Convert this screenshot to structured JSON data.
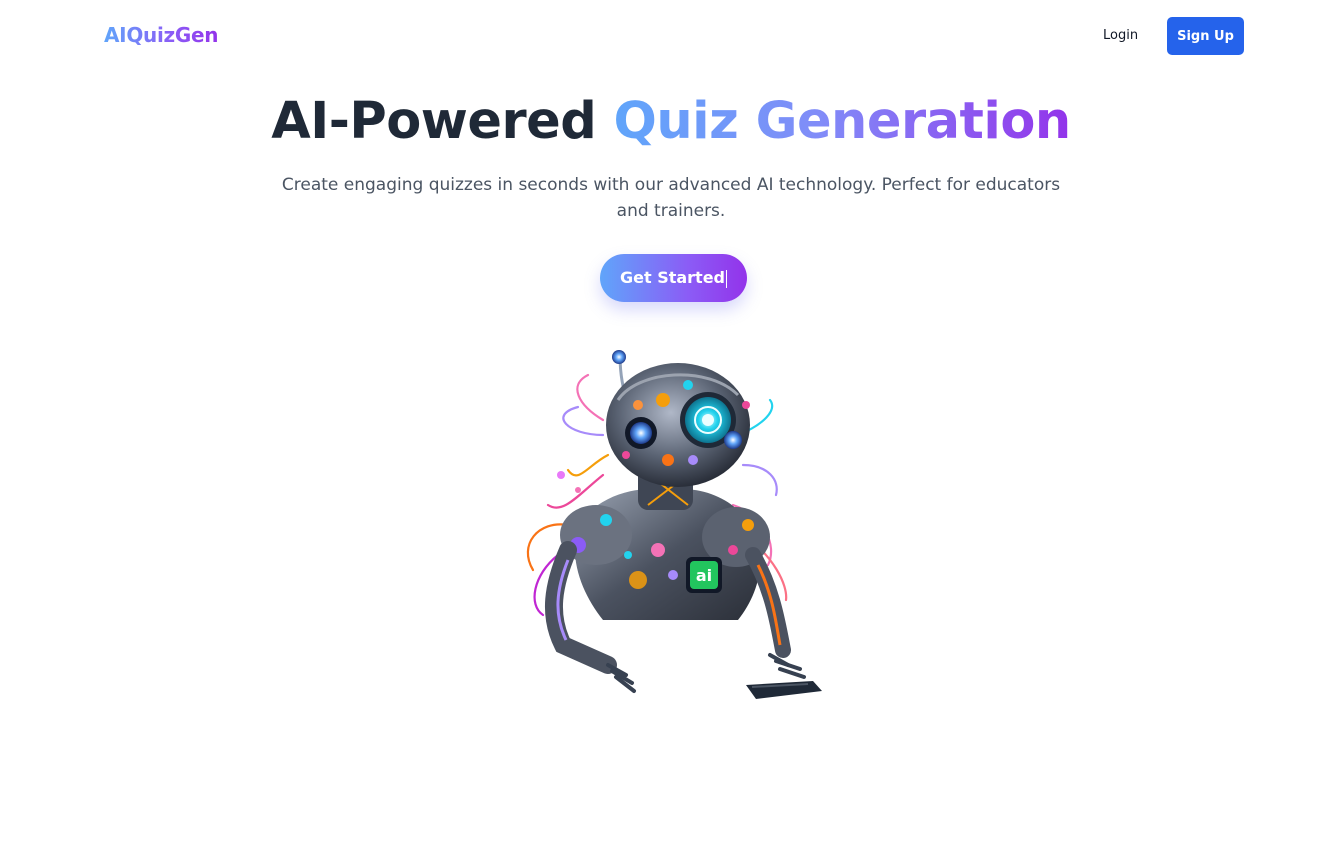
{
  "header": {
    "logo": "AIQuizGen",
    "login_label": "Login",
    "signup_label": "Sign Up"
  },
  "hero": {
    "title_plain": "AI-Powered",
    "title_accent": "Quiz Generation",
    "subtitle": "Create engaging quizzes in seconds with our advanced AI technology. Perfect for educators and trainers.",
    "cta_label": "Get Started",
    "illustration_badge": "ai"
  },
  "colors": {
    "primary": "#2563eb",
    "gradient_start": "#60a5fa",
    "gradient_end": "#9333ea",
    "heading": "#1f2937",
    "body_text": "#4b5563"
  },
  "icons": {
    "illustration": "ai-robot-illustration"
  }
}
